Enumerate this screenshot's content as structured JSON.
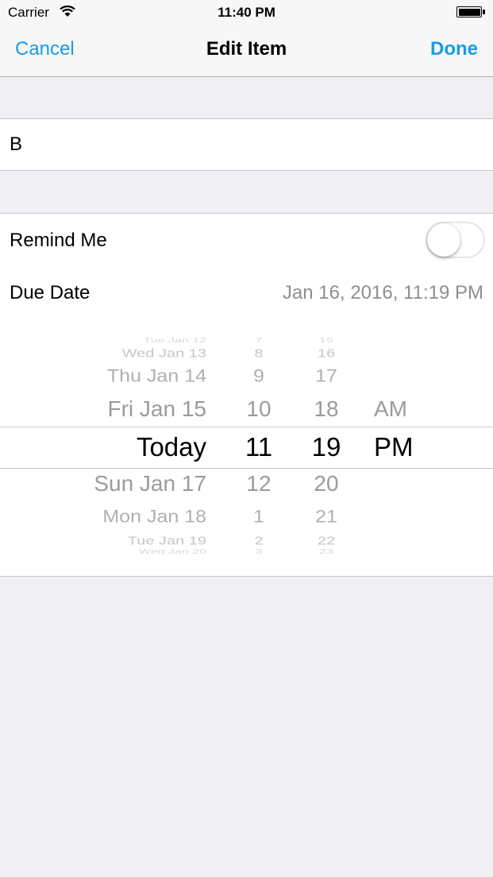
{
  "status_bar": {
    "carrier": "Carrier",
    "time": "11:40 PM"
  },
  "nav": {
    "cancel_label": "Cancel",
    "title": "Edit Item",
    "done_label": "Done"
  },
  "item": {
    "name": "B"
  },
  "settings": {
    "remind_label": "Remind Me",
    "remind_on": false,
    "due_label": "Due Date",
    "due_value": "Jan 16, 2016, 11:19 PM"
  },
  "picker": {
    "dates": [
      "Tue Jan 12",
      "Wed Jan 13",
      "Thu Jan 14",
      "Fri Jan 15",
      "Today",
      "Sun Jan 17",
      "Mon Jan 18",
      "Tue Jan 19",
      "Wed Jan 20"
    ],
    "hours": [
      "7",
      "8",
      "9",
      "10",
      "11",
      "12",
      "1",
      "2",
      "3"
    ],
    "minutes": [
      "15",
      "16",
      "17",
      "18",
      "19",
      "20",
      "21",
      "22",
      "23"
    ],
    "ampm": [
      "AM",
      "PM"
    ]
  },
  "colors": {
    "accent": "#1a9be6",
    "background": "#efeff4",
    "secondary_text": "#8e8e93"
  }
}
